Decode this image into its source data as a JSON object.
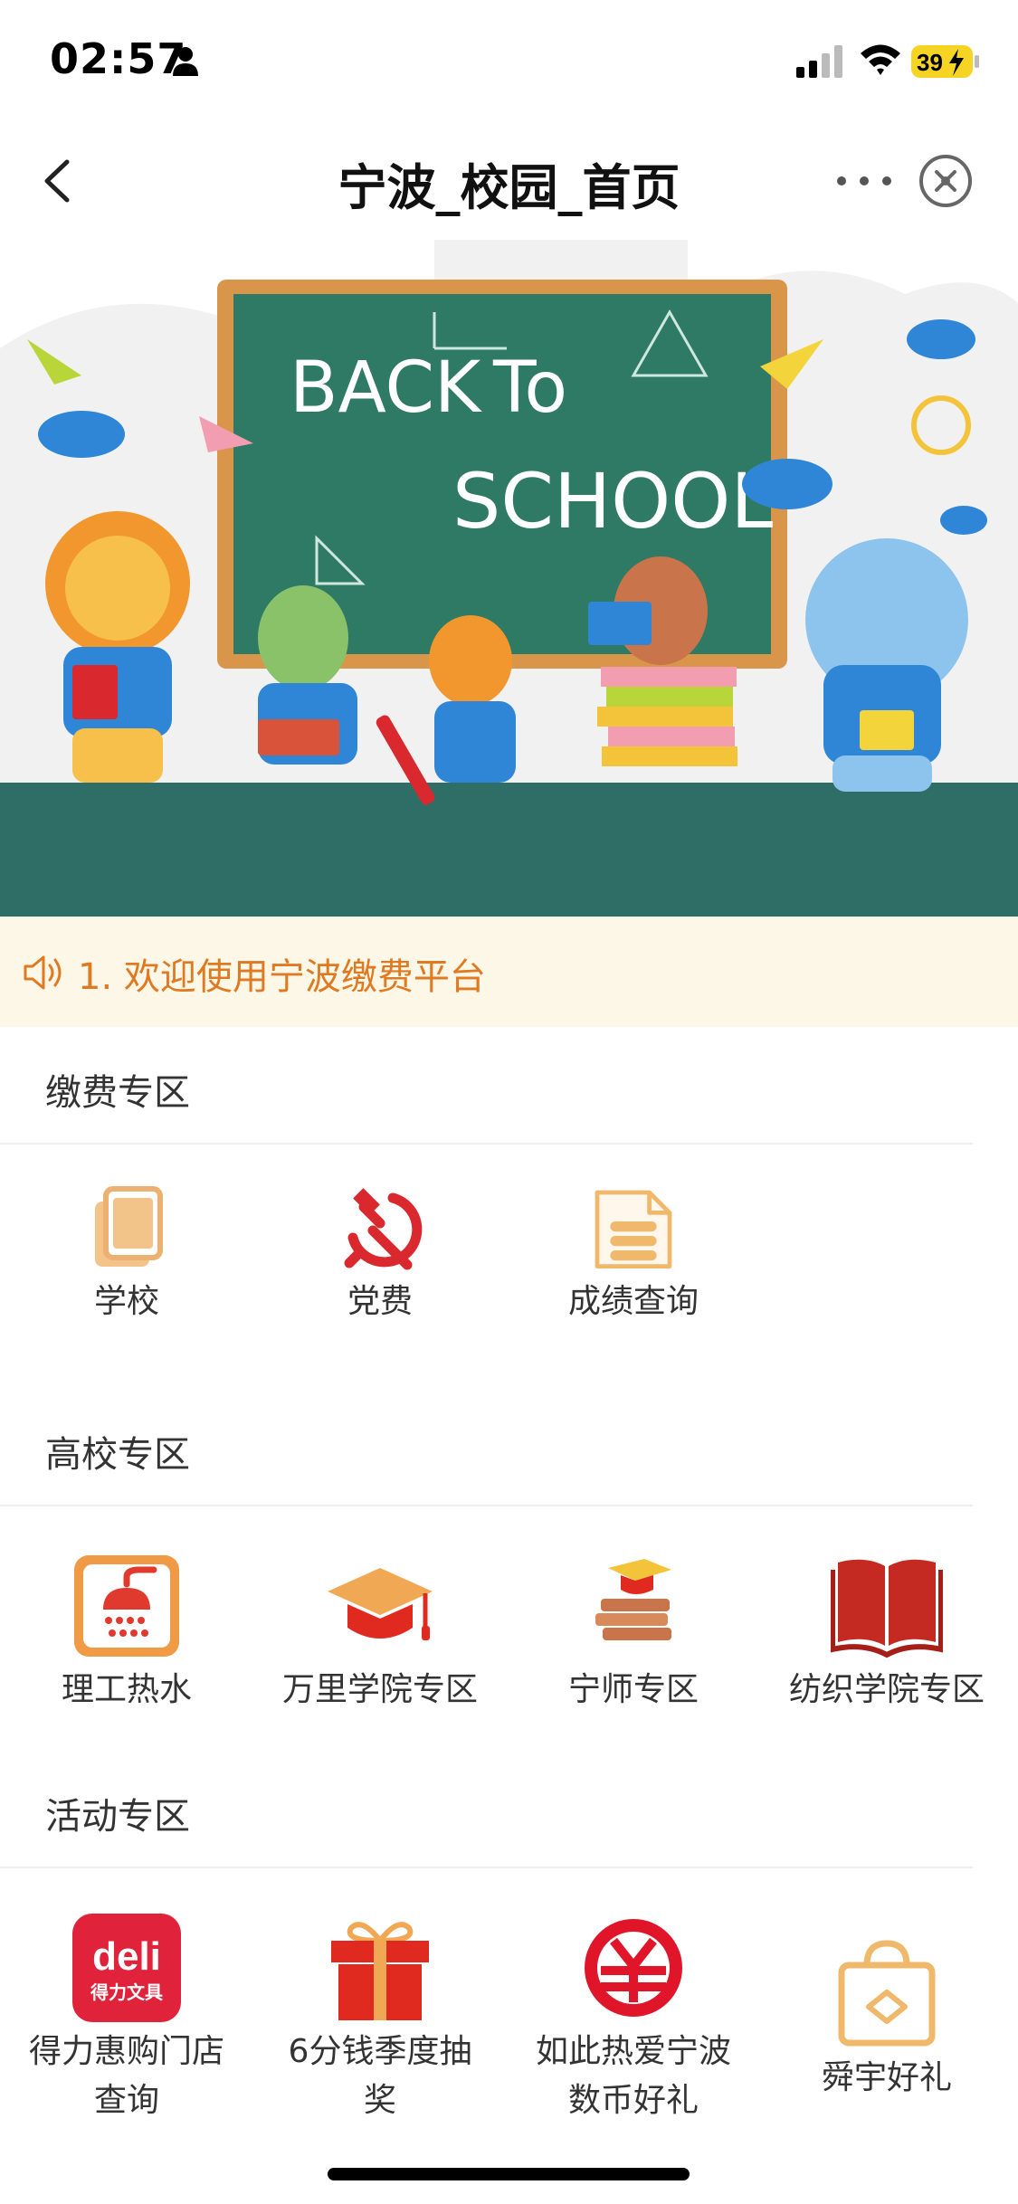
{
  "status": {
    "time": "02:57",
    "battery": "39"
  },
  "nav": {
    "title": "宁波_校园_首页"
  },
  "banner": {
    "line1": "BACK",
    "line2": "To",
    "line3": "SCHOOL"
  },
  "notice": {
    "text": "1. 欢迎使用宁波缴费平台"
  },
  "sections": [
    {
      "title": "缴费专区",
      "items": [
        {
          "label": "学校",
          "icon": "documents-icon"
        },
        {
          "label": "党费",
          "icon": "hammer-sickle-icon"
        },
        {
          "label": "成绩查询",
          "icon": "file-list-icon"
        }
      ]
    },
    {
      "title": "高校专区",
      "items": [
        {
          "label": "理工热水",
          "icon": "shower-icon"
        },
        {
          "label": "万里学院专区",
          "icon": "graduation-cap-icon"
        },
        {
          "label": "宁师专区",
          "icon": "books-cap-icon"
        },
        {
          "label": "纺织学院专区",
          "icon": "open-book-icon"
        }
      ]
    },
    {
      "title": "活动专区",
      "items": [
        {
          "label_line1": "得力惠购门店",
          "label_line2": "查询",
          "icon": "deli-logo-icon",
          "logo_text1": "deli",
          "logo_text2": "得力文具"
        },
        {
          "label_line1": "6分钱季度抽",
          "label_line2": "奖",
          "icon": "gift-icon"
        },
        {
          "label_line1": "如此热爱宁波",
          "label_line2": "数币好礼",
          "icon": "digital-yuan-icon"
        },
        {
          "label": "舜宇好礼",
          "icon": "shopping-bag-icon"
        }
      ]
    }
  ],
  "colors": {
    "accent": "#e07a22",
    "notice_bg": "#fdf7e7",
    "red": "#e02a20",
    "gold": "#f0b86a"
  }
}
